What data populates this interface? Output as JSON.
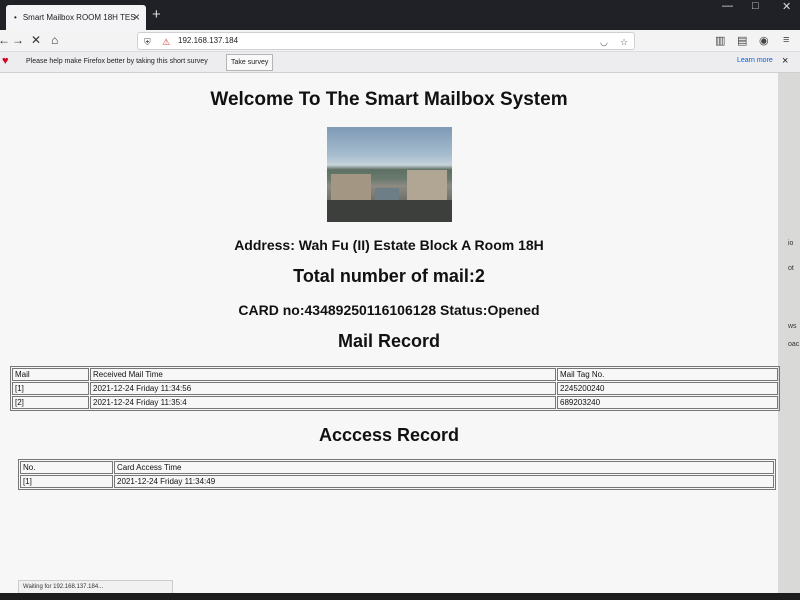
{
  "browser": {
    "tab_title": "Smart Mailbox ROOM 18H TES",
    "tab_close": "×",
    "new_tab": "+",
    "url": "192.168.137.184",
    "notification": {
      "message": "Please help make Firefox better by taking this short survey",
      "button": "Take survey",
      "link": "Learn more",
      "close": "×"
    },
    "status_text": "Waiting for 192.168.137.184..."
  },
  "page": {
    "title": "Welcome To The Smart Mailbox System",
    "address": "Address: Wah Fu (II) Estate Block A Room 18H",
    "total_mail": "Total number of mail:2",
    "card_status": "CARD no:43489250116106128 Status:Opened",
    "mail_record_heading": "Mail Record",
    "mail_table": {
      "headers": [
        "Mail",
        "Received Mail Time",
        "Mail Tag No."
      ],
      "rows": [
        [
          "[1]",
          "2021-12-24 Friday 11:34:56",
          "2245200240"
        ],
        [
          "[2]",
          "2021-12-24 Friday 11:35:4",
          "689203240"
        ]
      ]
    },
    "access_record_heading": "Acccess Record",
    "access_table": {
      "headers": [
        "No.",
        "Card Access Time"
      ],
      "rows": [
        [
          "[1]",
          "2021-12-24 Friday 11:34:49"
        ]
      ]
    }
  },
  "edge_fragments": [
    "io",
    "ot",
    "ws",
    "oac"
  ],
  "icons": [
    "back-icon",
    "forward-icon",
    "stop-icon",
    "home-icon",
    "shield-icon",
    "lock-icon",
    "pocket-icon",
    "star-icon",
    "library-icon",
    "sidebar-icon",
    "account-icon",
    "menu-icon",
    "heart-icon"
  ]
}
